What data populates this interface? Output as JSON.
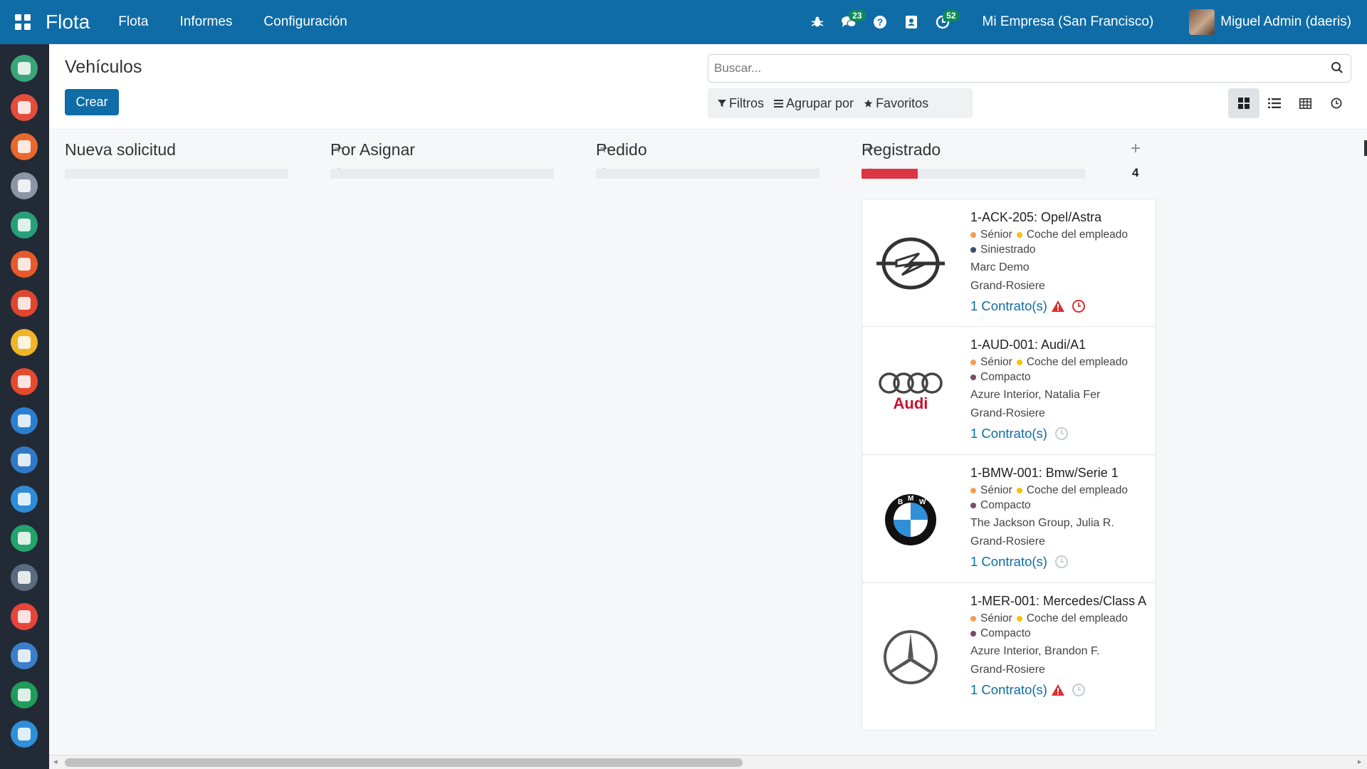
{
  "topbar": {
    "brand": "Flota",
    "nav": [
      "Flota",
      "Informes",
      "Configuración"
    ],
    "badges": {
      "messages": "23",
      "activities": "52"
    },
    "company": "Mi Empresa (San Francisco)",
    "user": "Miguel Admin (daeris)"
  },
  "rail": {
    "icons": [
      {
        "name": "discuss-app-icon",
        "color": "#3aa57a"
      },
      {
        "name": "calendar-app-icon",
        "color": "#e44d3a"
      },
      {
        "name": "notes-app-icon",
        "color": "#e8692c"
      },
      {
        "name": "contacts-app-icon",
        "color": "#8a95a5"
      },
      {
        "name": "crm-app-icon",
        "color": "#27a07a"
      },
      {
        "name": "sales-app-icon",
        "color": "#e8592c"
      },
      {
        "name": "dashboard-app-icon",
        "color": "#e0452e"
      },
      {
        "name": "employees-app-icon",
        "color": "#f0b429"
      },
      {
        "name": "expenses-app-icon",
        "color": "#e64a2e"
      },
      {
        "name": "pos-app-icon",
        "color": "#2b7fd0"
      },
      {
        "name": "accounting-app-icon",
        "color": "#3178c6"
      },
      {
        "name": "planning-app-icon",
        "color": "#2f8cd8"
      },
      {
        "name": "timesheet-app-icon",
        "color": "#25a36f"
      },
      {
        "name": "website-app-icon",
        "color": "#5a6b80"
      },
      {
        "name": "events-app-icon",
        "color": "#e8453a"
      },
      {
        "name": "survey-app-icon",
        "color": "#3b7fc9"
      },
      {
        "name": "marketing-app-icon",
        "color": "#1f9c5a"
      },
      {
        "name": "documents-app-icon",
        "color": "#2f8fd8"
      }
    ]
  },
  "control": {
    "title": "Vehículos",
    "create_label": "Crear",
    "search_placeholder": "Buscar...",
    "filters_label": "Filtros",
    "groupby_label": "Agrupar por",
    "favorites_label": "Favoritos"
  },
  "columns": [
    {
      "title": "Nueva solicitud",
      "count": "0",
      "progress": 0
    },
    {
      "title": "Por Asignar",
      "count": "0",
      "progress": 0
    },
    {
      "title": "Pedido",
      "count": "0",
      "progress": 0
    },
    {
      "title": "Registrado",
      "count": "4",
      "progress": 0.25
    }
  ],
  "cards": [
    {
      "name": "1-ACK-205: Opel/Astra",
      "tags": [
        {
          "label": "Sénior",
          "color": "#f0a050"
        },
        {
          "label": "Coche del empleado",
          "color": "#f4c20d"
        },
        {
          "label": "Siniestrado",
          "color": "#34506e"
        }
      ],
      "driver": "Marc Demo",
      "location": "Grand-Rosiere",
      "contracts": "1 Contrato(s)",
      "warning": true,
      "activity_color": "#dc2e2e",
      "logo": "opel-logo"
    },
    {
      "name": "1-AUD-001: Audi/A1",
      "tags": [
        {
          "label": "Sénior",
          "color": "#f0a050"
        },
        {
          "label": "Coche del empleado",
          "color": "#f4c20d"
        },
        {
          "label": "Compacto",
          "color": "#7a4a6a"
        }
      ],
      "driver": "Azure Interior, Natalia Fer",
      "location": "Grand-Rosiere",
      "contracts": "1 Contrato(s)",
      "warning": false,
      "activity_color": "#c8ccd2",
      "logo": "audi-logo",
      "logo_text": "Audi"
    },
    {
      "name": "1-BMW-001: Bmw/Serie 1",
      "tags": [
        {
          "label": "Sénior",
          "color": "#f0a050"
        },
        {
          "label": "Coche del empleado",
          "color": "#f4c20d"
        },
        {
          "label": "Compacto",
          "color": "#7a4a6a"
        }
      ],
      "driver": "The Jackson Group, Julia R.",
      "location": "Grand-Rosiere",
      "contracts": "1 Contrato(s)",
      "warning": false,
      "activity_color": "#c8ccd2",
      "logo": "bmw-logo"
    },
    {
      "name": "1-MER-001: Mercedes/Class A",
      "tags": [
        {
          "label": "Sénior",
          "color": "#f0a050"
        },
        {
          "label": "Coche del empleado",
          "color": "#f4c20d"
        },
        {
          "label": "Compacto",
          "color": "#7a4a6a"
        }
      ],
      "driver": "Azure Interior, Brandon F.",
      "location": "Grand-Rosiere",
      "contracts": "1 Contrato(s)",
      "warning": true,
      "activity_color": "#c8ccd2",
      "logo": "mercedes-logo"
    }
  ],
  "colors": {
    "primary": "#0f6ca6",
    "danger": "#dc3545"
  }
}
